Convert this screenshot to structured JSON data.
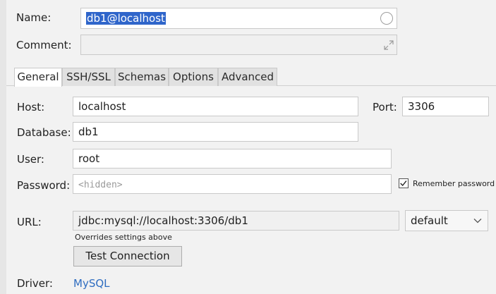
{
  "name": {
    "label": "Name:",
    "value": "db1@localhost"
  },
  "comment": {
    "label": "Comment:",
    "value": ""
  },
  "tabs": [
    {
      "label": "General",
      "active": true
    },
    {
      "label": "SSH/SSL",
      "active": false
    },
    {
      "label": "Schemas",
      "active": false
    },
    {
      "label": "Options",
      "active": false
    },
    {
      "label": "Advanced",
      "active": false
    }
  ],
  "host": {
    "label": "Host:",
    "value": "localhost"
  },
  "port": {
    "label": "Port:",
    "value": "3306"
  },
  "database": {
    "label": "Database:",
    "value": "db1"
  },
  "user": {
    "label": "User:",
    "value": "root"
  },
  "password": {
    "label": "Password:",
    "placeholder": "<hidden>"
  },
  "remember_password": {
    "label": "Remember password",
    "checked": true
  },
  "url": {
    "label": "URL:",
    "value": "jdbc:mysql://localhost:3306/db1",
    "hint": "Overrides settings above"
  },
  "url_mode": {
    "selected": "default"
  },
  "test_connection": {
    "label": "Test Connection"
  },
  "driver": {
    "label": "Driver:",
    "value": "MySQL"
  },
  "colors": {
    "selection": "#2f65ca",
    "link": "#2f6dc0"
  },
  "icons": {
    "name_status": "circle-icon",
    "comment_expand": "expand-icon",
    "checkbox": "check-icon",
    "dropdown": "chevron-down-icon"
  }
}
